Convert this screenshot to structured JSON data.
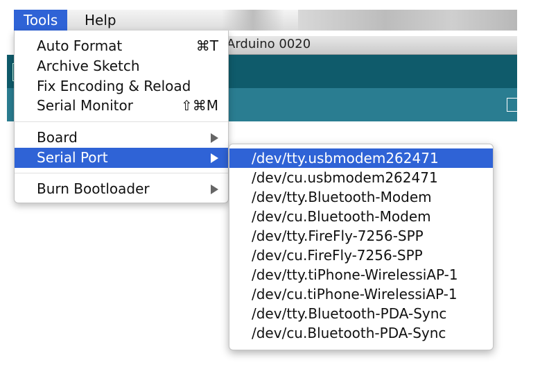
{
  "menubar": {
    "tools": "Tools",
    "help": "Help"
  },
  "window": {
    "title": "Arduino 0020"
  },
  "tools_menu": {
    "group1": [
      {
        "label": "Auto Format",
        "shortcut": "⌘T"
      },
      {
        "label": "Archive Sketch",
        "shortcut": ""
      },
      {
        "label": "Fix Encoding & Reload",
        "shortcut": ""
      },
      {
        "label": "Serial Monitor",
        "shortcut": "⇧⌘M"
      }
    ],
    "board": "Board",
    "serial_port": "Serial Port",
    "burn_bootloader": "Burn Bootloader"
  },
  "serial_ports": [
    "/dev/tty.usbmodem262471",
    "/dev/cu.usbmodem262471",
    "/dev/tty.Bluetooth-Modem",
    "/dev/cu.Bluetooth-Modem",
    "/dev/tty.FireFly-7256-SPP",
    "/dev/cu.FireFly-7256-SPP",
    "/dev/tty.tiPhone-WirelessiAP-1",
    "/dev/cu.tiPhone-WirelessiAP-1",
    "/dev/tty.Bluetooth-PDA-Sync",
    "/dev/cu.Bluetooth-PDA-Sync"
  ],
  "colors": {
    "highlight": "#2f63d6",
    "toolbar": "#0f5b6b",
    "tabbar": "#2a7d91"
  }
}
